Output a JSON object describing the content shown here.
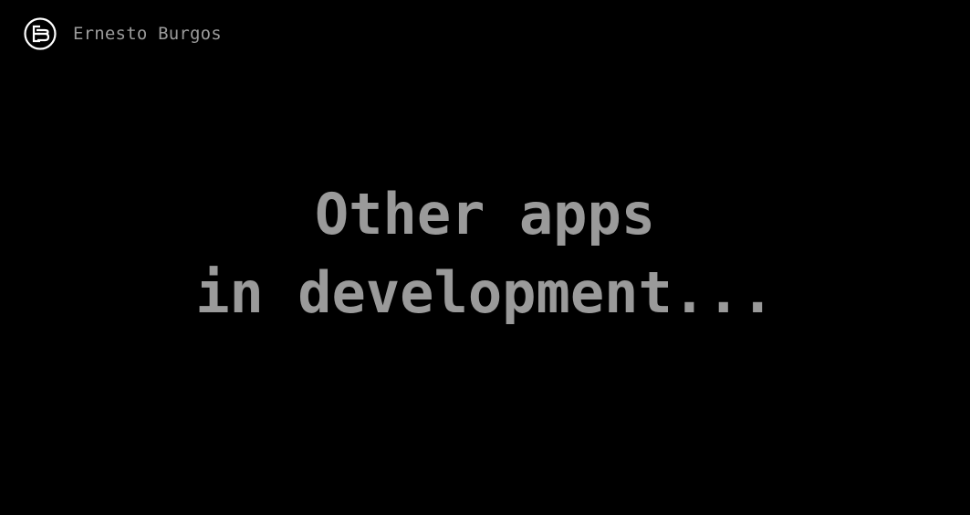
{
  "header": {
    "logo_icon": "eb-monogram-logo-icon",
    "author_name": "Ernesto Burgos"
  },
  "main": {
    "line1": "Other apps",
    "line2": "in development..."
  },
  "colors": {
    "background": "#000000",
    "text": "#9a9a9a",
    "logo": "#ffffff"
  }
}
